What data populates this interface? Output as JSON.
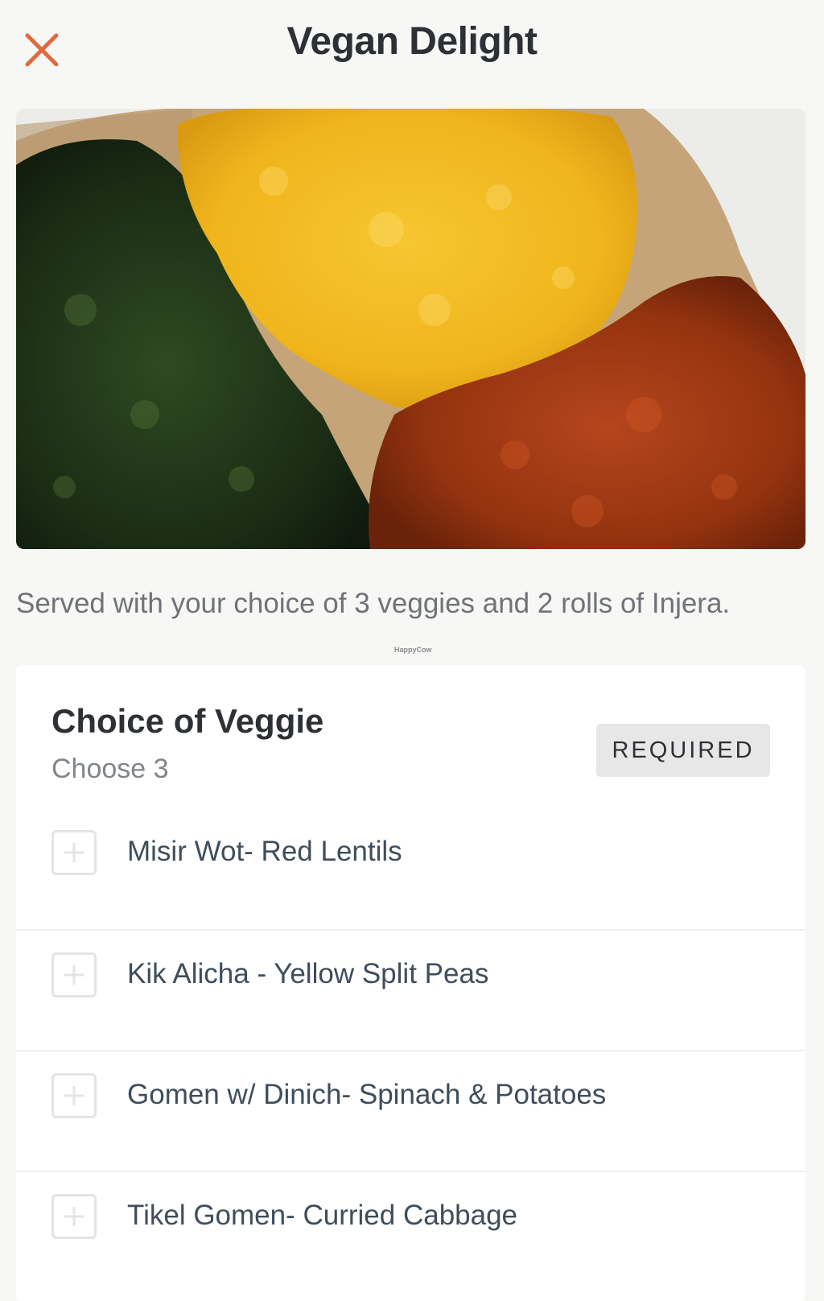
{
  "header": {
    "title": "Vegan Delight",
    "close_icon": "close-icon",
    "accent_color": "#e06a3f"
  },
  "hero": {
    "image": "photo-of-misir-kik-gomen-on-injera"
  },
  "description": "Served with your choice of 3 veggies and 2 rolls of Injera.",
  "watermark": "HappyCow",
  "section": {
    "title": "Choice of Veggie",
    "subtitle": "Choose 3",
    "badge": "REQUIRED",
    "options": [
      {
        "label": "Misir Wot- Red Lentils",
        "icon": "plus-icon",
        "checked": false
      },
      {
        "label": "Kik Alicha - Yellow Split Peas",
        "icon": "plus-icon",
        "checked": false
      },
      {
        "label": "Gomen w/ Dinich- Spinach & Potatoes",
        "icon": "plus-icon",
        "checked": false
      },
      {
        "label": "Tikel Gomen- Curried Cabbage",
        "icon": "plus-icon",
        "checked": false
      }
    ]
  }
}
